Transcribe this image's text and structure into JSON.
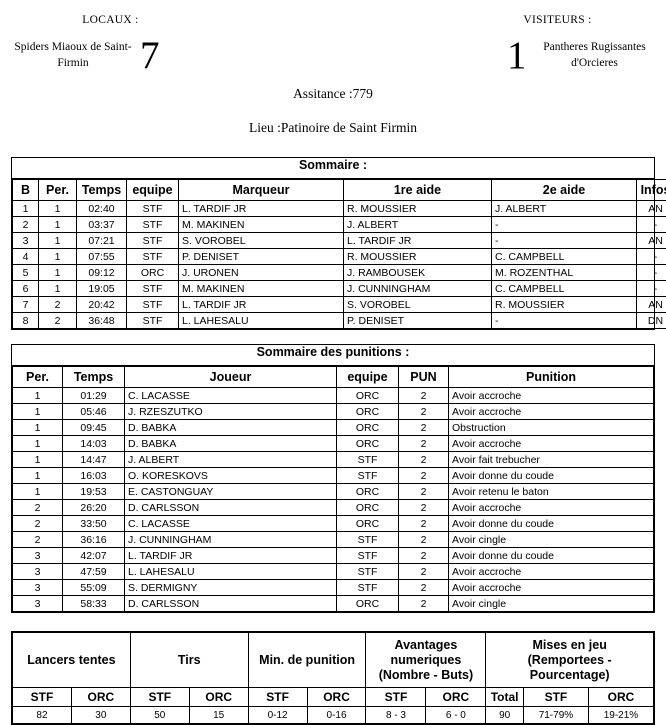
{
  "header": {
    "home_caption": "LOCAUX :",
    "home_team": "Spiders Miaoux de Saint-Firmin",
    "home_score": "7",
    "away_caption": "VISITEURS :",
    "away_team": "Pantheres Rugissantes d'Orcieres",
    "away_score": "1",
    "attendance": "Assitance :779",
    "venue": "Lieu :Patinoire de Saint Firmin"
  },
  "goals": {
    "caption": "Sommaire :",
    "columns": [
      "B",
      "Per.",
      "Temps",
      "equipe",
      "Marqueur",
      "1re aide",
      "2e aide",
      "Infos"
    ],
    "rows": [
      [
        "1",
        "1",
        "02:40",
        "STF",
        "L. TARDIF JR",
        "R. MOUSSIER",
        "J. ALBERT",
        "AN"
      ],
      [
        "2",
        "1",
        "03:37",
        "STF",
        "M. MAKINEN",
        "J. ALBERT",
        "-",
        "-"
      ],
      [
        "3",
        "1",
        "07:21",
        "STF",
        "S. VOROBEL",
        "L. TARDIF JR",
        "-",
        "AN"
      ],
      [
        "4",
        "1",
        "07:55",
        "STF",
        "P. DENISET",
        "R. MOUSSIER",
        "C. CAMPBELL",
        "-"
      ],
      [
        "5",
        "1",
        "09:12",
        "ORC",
        "J. URONEN",
        "J. RAMBOUSEK",
        "M. ROZENTHAL",
        "-"
      ],
      [
        "6",
        "1",
        "19:05",
        "STF",
        "M. MAKINEN",
        "J. CUNNINGHAM",
        "C. CAMPBELL",
        "-"
      ],
      [
        "7",
        "2",
        "20:42",
        "STF",
        "L. TARDIF JR",
        "S. VOROBEL",
        "R. MOUSSIER",
        "AN"
      ],
      [
        "8",
        "2",
        "36:48",
        "STF",
        "L. LAHESALU",
        "P. DENISET",
        "-",
        "DN"
      ]
    ]
  },
  "penalties": {
    "caption": "Sommaire des punitions :",
    "columns": [
      "Per.",
      "Temps",
      "Joueur",
      "equipe",
      "PUN",
      "Punition"
    ],
    "rows": [
      [
        "1",
        "01:29",
        "C. LACASSE",
        "ORC",
        "2",
        "Avoir accroche"
      ],
      [
        "1",
        "05:46",
        "J. RZESZUTKO",
        "ORC",
        "2",
        "Avoir accroche"
      ],
      [
        "1",
        "09:45",
        "D. BABKA",
        "ORC",
        "2",
        "Obstruction"
      ],
      [
        "1",
        "14:03",
        "D. BABKA",
        "ORC",
        "2",
        "Avoir accroche"
      ],
      [
        "1",
        "14:47",
        "J. ALBERT",
        "STF",
        "2",
        "Avoir fait trebucher"
      ],
      [
        "1",
        "16:03",
        "O. KORESKOVS",
        "STF",
        "2",
        "Avoir donne du coude"
      ],
      [
        "1",
        "19:53",
        "E. CASTONGUAY",
        "ORC",
        "2",
        "Avoir retenu le baton"
      ],
      [
        "2",
        "26:20",
        "D. CARLSSON",
        "ORC",
        "2",
        "Avoir accroche"
      ],
      [
        "2",
        "33:50",
        "C. LACASSE",
        "ORC",
        "2",
        "Avoir donne du coude"
      ],
      [
        "2",
        "36:16",
        "J. CUNNINGHAM",
        "STF",
        "2",
        "Avoir cingle"
      ],
      [
        "3",
        "42:07",
        "L. TARDIF JR",
        "STF",
        "2",
        "Avoir donne du coude"
      ],
      [
        "3",
        "47:59",
        "L. LAHESALU",
        "STF",
        "2",
        "Avoir accroche"
      ],
      [
        "3",
        "55:09",
        "S. DERMIGNY",
        "STF",
        "2",
        "Avoir accroche"
      ],
      [
        "3",
        "58:33",
        "D. CARLSSON",
        "ORC",
        "2",
        "Avoir cingle"
      ]
    ]
  },
  "stats": {
    "groups": [
      "Lancers tentes",
      "Tirs",
      "Min. de punition",
      "Avantages numeriques (Nombre - Buts)",
      "Mises en jeu (Remportees - Pourcentage)"
    ],
    "group_lancers": "Lancers tentes",
    "group_tirs": "Tirs",
    "group_pim": "Min. de punition",
    "group_pp": "Avantages\nnumeriques\n(Nombre - Buts)",
    "group_fo": "Mises en jeu\n(Remportees -\nPourcentage)",
    "subheaders": [
      "STF",
      "ORC",
      "STF",
      "ORC",
      "STF",
      "ORC",
      "STF",
      "ORC",
      "Total",
      "STF",
      "ORC"
    ],
    "values": [
      "82",
      "30",
      "50",
      "15",
      "0-12",
      "0-16",
      "8 - 3",
      "6 - 0",
      "90",
      "71-79%",
      "19-21%"
    ]
  }
}
